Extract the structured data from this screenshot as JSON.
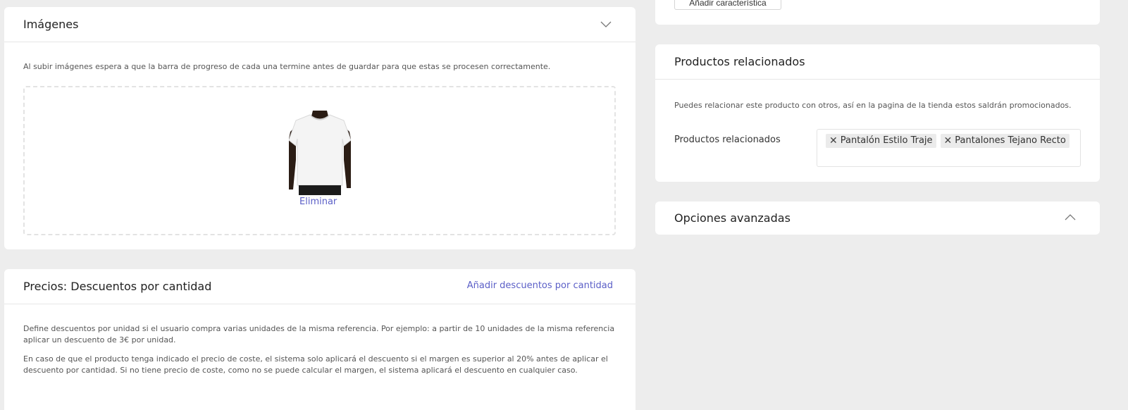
{
  "imagenes": {
    "title": "Imágenes",
    "help": "Al subir imágenes espera a que la barra de progreso de cada una termine antes de guardar para que estas se procesen correctamente.",
    "delete_label": "Eliminar"
  },
  "precios": {
    "title": "Precios: Descuentos por cantidad",
    "add_link": "Añadir descuentos por cantidad",
    "help1": "Define descuentos por unidad si el usuario compra varias unidades de la misma referencia. Por ejemplo: a partir de 10 unidades de la misma referencia aplicar un descuento de 3€ por unidad.",
    "help2": "En caso de que el producto tenga indicado el precio de coste, el sistema solo aplicará el descuento si el margen es superior al 20% antes de aplicar el descuento por cantidad. Si no tiene precio de coste, como no se puede calcular el margen, el sistema aplicará el descuento en cualquier caso."
  },
  "caracteristicas": {
    "add_button": "Añadir característica"
  },
  "relacionados": {
    "title": "Productos relacionados",
    "help": "Puedes relacionar este producto con otros, así en la pagina de la tienda estos saldrán promocionados.",
    "field_label": "Productos relacionados",
    "tags": [
      "Pantalón Estilo Traje",
      "Pantalones Tejano Recto"
    ],
    "remove_symbol": "✕"
  },
  "opciones": {
    "title": "Opciones avanzadas"
  },
  "colors": {
    "link": "#5b5fc7",
    "background": "#ededed"
  }
}
